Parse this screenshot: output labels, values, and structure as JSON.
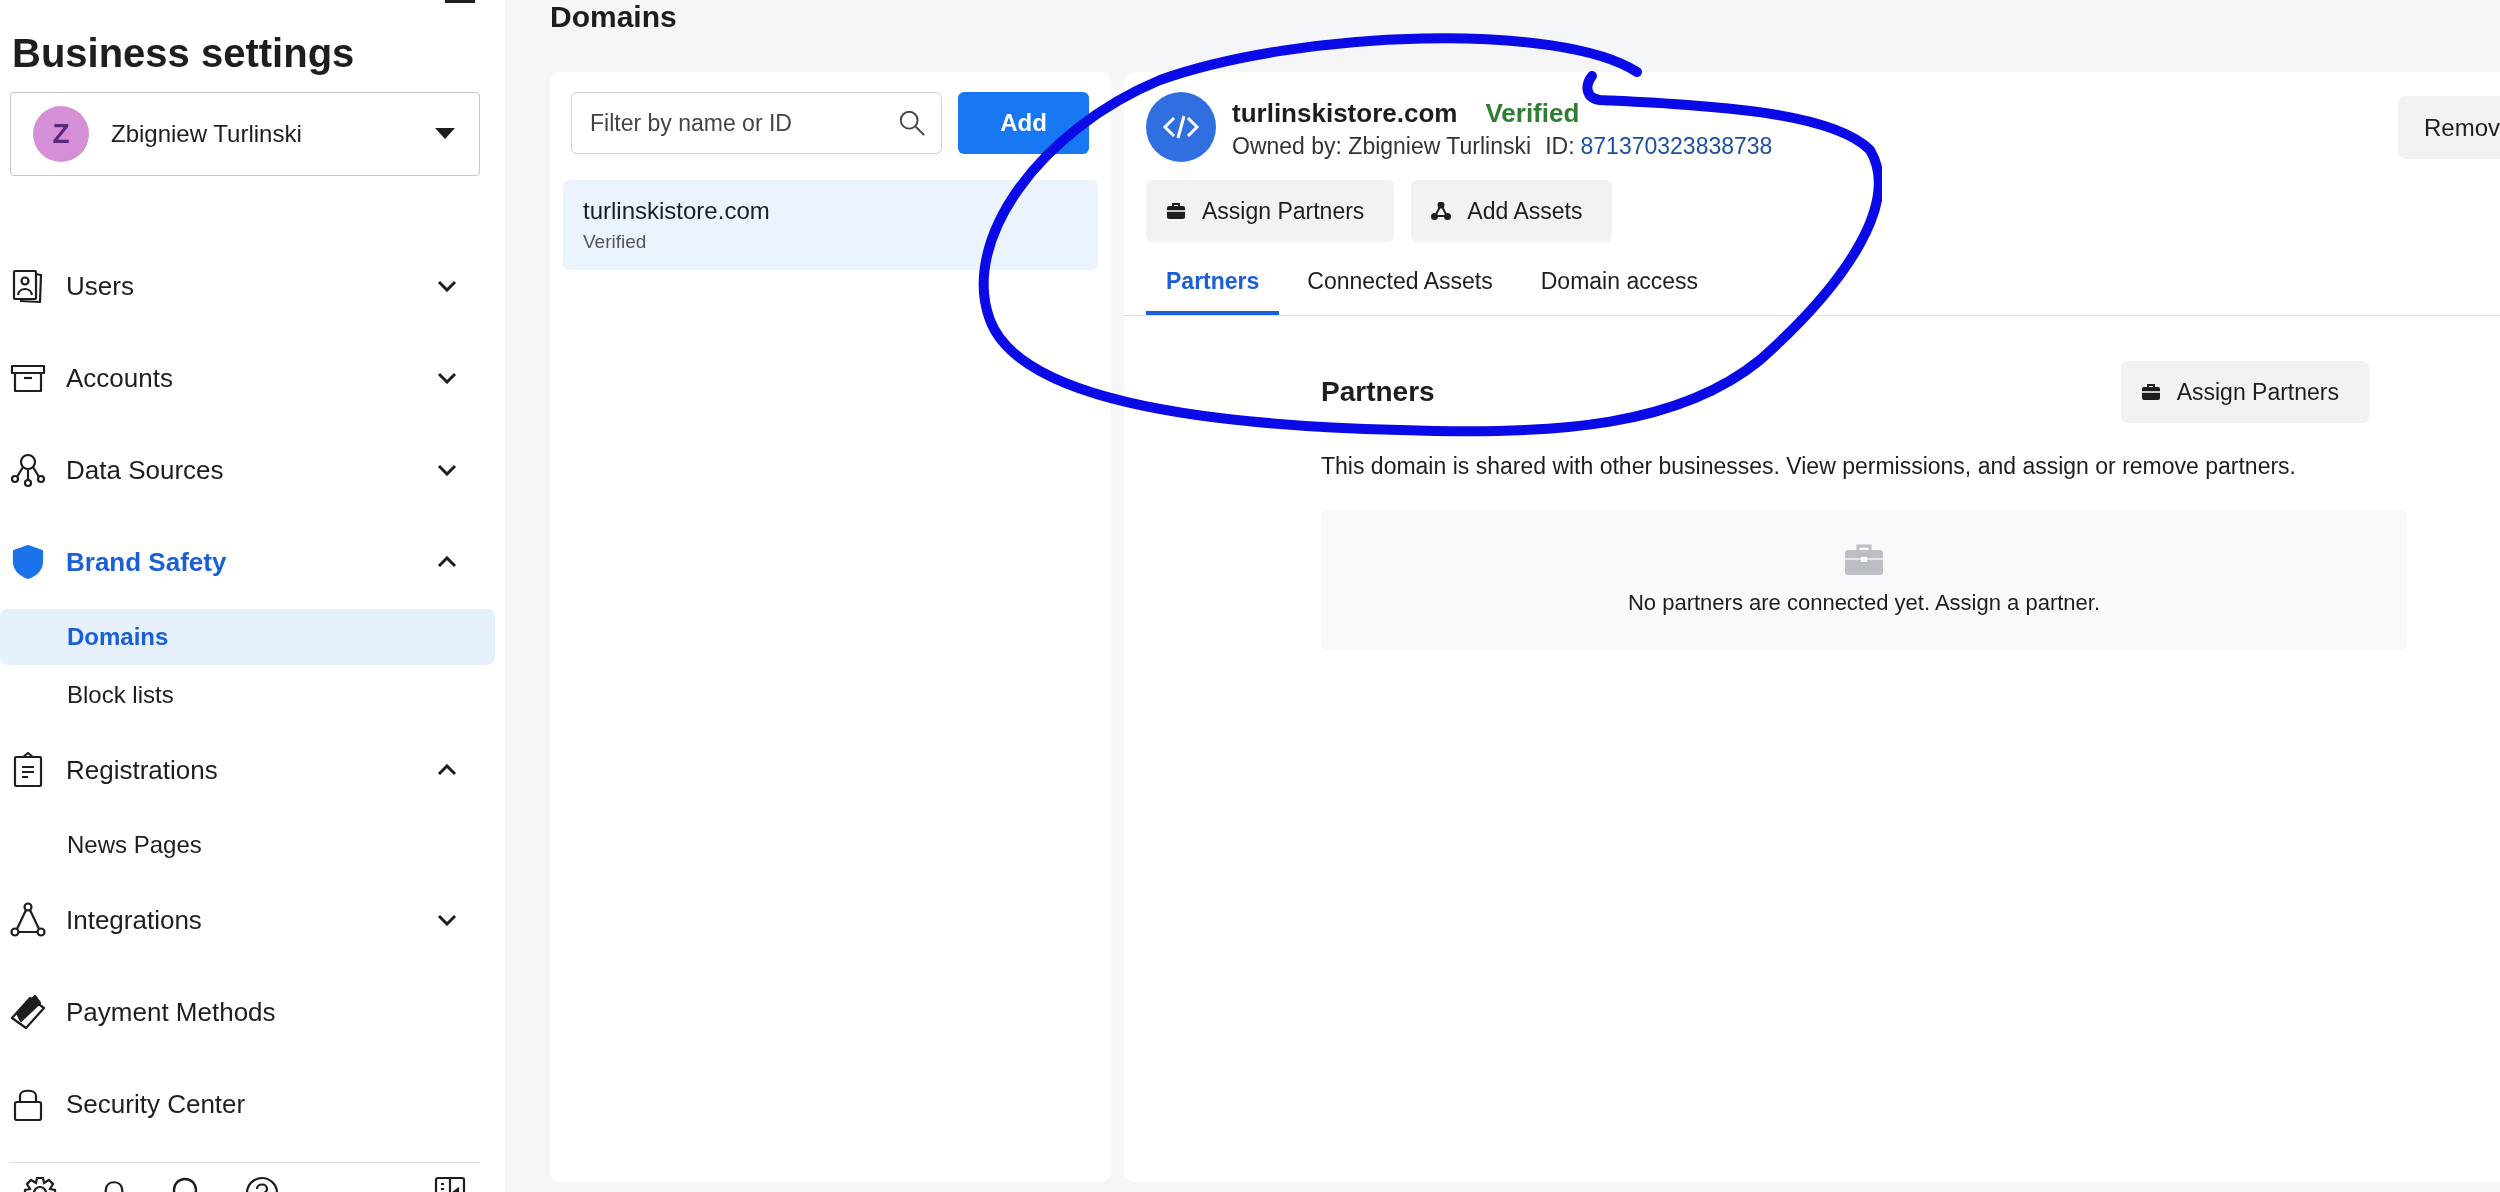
{
  "sidebar": {
    "title": "Business settings",
    "account": {
      "initial": "Z",
      "name": "Zbigniew Turlinski"
    },
    "nav": [
      {
        "label": "Users",
        "kind": "users",
        "selected": false,
        "expanded": false
      },
      {
        "label": "Accounts",
        "kind": "accounts",
        "selected": false,
        "expanded": false
      },
      {
        "label": "Data Sources",
        "kind": "data-sources",
        "selected": false,
        "expanded": false
      },
      {
        "label": "Brand Safety",
        "kind": "shield",
        "selected": true,
        "expanded": true,
        "children": [
          {
            "label": "Domains",
            "selected": true
          },
          {
            "label": "Block lists",
            "selected": false
          }
        ]
      },
      {
        "label": "Registrations",
        "kind": "registrations",
        "selected": false,
        "expanded": true,
        "children": [
          {
            "label": "News Pages",
            "selected": false
          }
        ]
      },
      {
        "label": "Integrations",
        "kind": "integrations",
        "selected": false,
        "expanded": false
      },
      {
        "label": "Payment Methods",
        "kind": "payment",
        "selected": false
      },
      {
        "label": "Security Center",
        "kind": "lock",
        "selected": false
      }
    ]
  },
  "page_title": "Domains",
  "domain_list": {
    "search": {
      "placeholder": "Filter by name or ID"
    },
    "add_button": "Add",
    "items": [
      {
        "name": "turlinskistore.com",
        "status": "Verified",
        "selected": true
      }
    ]
  },
  "detail": {
    "name": "turlinskistore.com",
    "status": "Verified",
    "owner": "Owned by: Zbigniew Turlinski",
    "id_label": "ID:",
    "id": "871370323838738",
    "remove_button": "Remov",
    "actions": [
      {
        "label": "Assign Partners",
        "kind": "briefcase"
      },
      {
        "label": "Add Assets",
        "kind": "nodes"
      }
    ],
    "tabs": [
      {
        "label": "Partners",
        "selected": true
      },
      {
        "label": "Connected Assets",
        "selected": false
      },
      {
        "label": "Domain access",
        "selected": false
      }
    ],
    "section": {
      "title": "Partners",
      "button": "Assign Partners",
      "description": "This domain is shared with other businesses. View permissions, and assign or remove partners.",
      "empty_text": "No partners are connected yet. Assign a partner."
    }
  }
}
